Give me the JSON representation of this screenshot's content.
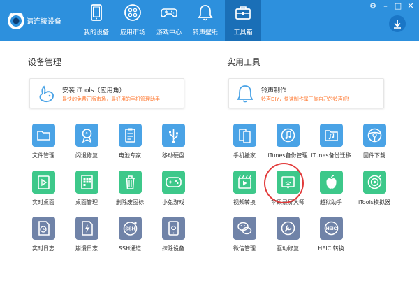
{
  "header": {
    "connection_status": "请连接设备",
    "nav": [
      {
        "label": "我的设备",
        "icon": "tablet-icon",
        "active": false
      },
      {
        "label": "应用市场",
        "icon": "apps-grid-icon",
        "active": false
      },
      {
        "label": "游戏中心",
        "icon": "gamepad-icon",
        "active": false
      },
      {
        "label": "铃声壁纸",
        "icon": "bell-icon",
        "active": false
      },
      {
        "label": "工具箱",
        "icon": "toolbox-icon",
        "active": true
      }
    ]
  },
  "device_section": {
    "title": "设备管理",
    "card": {
      "title": "安装 iTools（应用角）",
      "subtitle": "最快的免费正版市场，最好用的手机管理助手"
    },
    "tools": [
      {
        "label": "文件管理",
        "icon": "folder-icon",
        "color": "blue"
      },
      {
        "label": "闪退修复",
        "icon": "medal-icon",
        "color": "blue"
      },
      {
        "label": "电池专家",
        "icon": "clipboard-icon",
        "color": "blue"
      },
      {
        "label": "移动硬盘",
        "icon": "usb-icon",
        "color": "blue"
      },
      {
        "label": "实时桌面",
        "icon": "play-icon",
        "color": "green"
      },
      {
        "label": "桌面管理",
        "icon": "grid-icon",
        "color": "green"
      },
      {
        "label": "删除废图标",
        "icon": "trash-icon",
        "color": "green"
      },
      {
        "label": "小兔游戏",
        "icon": "gamepad-icon",
        "color": "green"
      },
      {
        "label": "实时日志",
        "icon": "clock-doc-icon",
        "color": "slate"
      },
      {
        "label": "崩溃日志",
        "icon": "lightning-doc-icon",
        "color": "slate"
      },
      {
        "label": "SSH通道",
        "icon": "ssh-icon",
        "color": "slate"
      },
      {
        "label": "抹除设备",
        "icon": "erase-icon",
        "color": "slate"
      }
    ]
  },
  "utility_section": {
    "title": "实用工具",
    "card": {
      "title": "铃声制作",
      "subtitle": "铃声DIY，快速制作属于你自己的铃声吧！"
    },
    "tools": [
      {
        "label": "手机搬家",
        "icon": "phone-move-icon",
        "color": "blue"
      },
      {
        "label": "iTunes备份管理",
        "icon": "music-disc-icon",
        "color": "blue"
      },
      {
        "label": "iTunes备份迁移",
        "icon": "music-folder-icon",
        "color": "blue"
      },
      {
        "label": "固件下载",
        "icon": "steering-icon",
        "color": "blue"
      },
      {
        "label": "视频转换",
        "icon": "video-icon",
        "color": "green"
      },
      {
        "label": "苹果录屏大师",
        "icon": "screen-mirror-icon",
        "color": "green"
      },
      {
        "label": "越狱助手",
        "icon": "apple-icon",
        "color": "green"
      },
      {
        "label": "iTools模拟器",
        "icon": "simulator-icon",
        "color": "green"
      },
      {
        "label": "微信管理",
        "icon": "wechat-icon",
        "color": "slate"
      },
      {
        "label": "驱动修复",
        "icon": "wrench-icon",
        "color": "slate"
      },
      {
        "label": "HEIC 转换",
        "icon": "heic-icon",
        "color": "slate"
      }
    ]
  }
}
